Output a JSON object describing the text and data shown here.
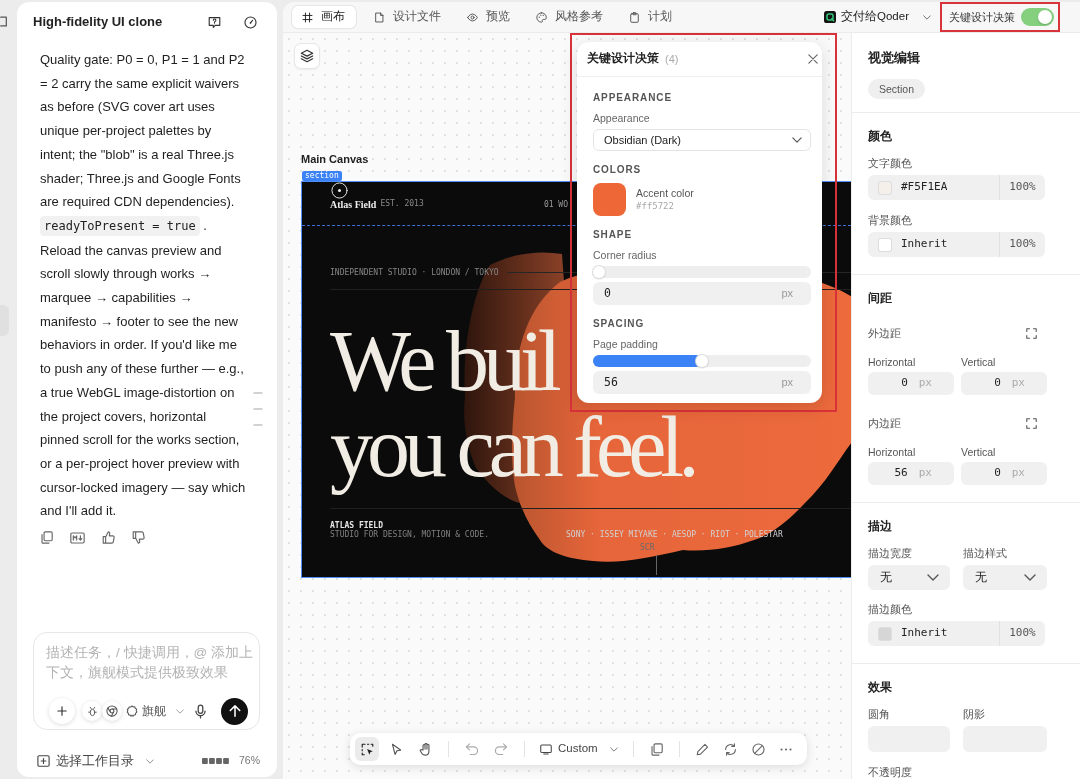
{
  "chat": {
    "title": "High-fidelity UI clone",
    "message": [
      {
        "kind": "text",
        "text": "Quality gate: P0 = 0, P1 = 1 and P2 = 2 carry the same explicit waivers as before (SVG cover art uses unique per-project palettes by intent; the \"blob\" is a real Three.js shader; Three.js and Google Fonts are required CDN dependencies)."
      },
      {
        "kind": "code",
        "text": "readyToPresent = true"
      },
      {
        "kind": "text",
        "text": "."
      },
      {
        "kind": "paragraph",
        "text": "Reload the canvas preview and scroll slowly through works → marquee → capabilities → manifesto → footer to see the new behaviors in order. If you'd like me to push any of these further — e.g., a true WebGL image-distortion on the project covers, horizontal pinned scroll for the works section, or a per-project hover preview with cursor-locked imagery — say which and I'll add it."
      }
    ],
    "composer": {
      "placeholder": "描述任务，/ 快捷调用，@ 添加上下文，旗舰模式提供极致效果",
      "mode": "旗舰"
    },
    "footer": {
      "workspace": "选择工作目录",
      "usage": "76%"
    }
  },
  "topbar": {
    "tabs": [
      {
        "label": "画布",
        "selected": true
      },
      {
        "label": "设计文件",
        "selected": false
      },
      {
        "label": "预览",
        "selected": false
      },
      {
        "label": "风格参考",
        "selected": false
      },
      {
        "label": "计划",
        "selected": false
      }
    ],
    "handoff": "交付给Qoder",
    "decisions": {
      "label": "关键设计决策",
      "on": true
    }
  },
  "canvas": {
    "frame_label": "Main Canvas",
    "frame_tag": "section",
    "artboard": {
      "brand": "Atlas Field",
      "established": "EST. 2013",
      "nav_link": "01 WO",
      "tagline": "INDEPENDENT STUDIO · LONDON / TOKYO",
      "headline": [
        "We buil",
        "you can feel."
      ],
      "footer_title": "ATLAS FIELD",
      "footer_text": "STUDIO FOR DESIGN, MOTION & CODE.",
      "clients": "SONY · ISSEY MIYAKE · AESOP · RIOT · POLESTAR",
      "scroll_hint": "SCR"
    }
  },
  "decisions_panel": {
    "title": "关键设计决策",
    "count": "(4)",
    "sections": [
      {
        "heading": "APPEARANCE",
        "kind": "select",
        "label": "Appearance",
        "value": "Obsidian (Dark)"
      },
      {
        "heading": "COLORS",
        "kind": "color",
        "label": "Accent color",
        "value": "#ff5722",
        "color": "#ee6736"
      },
      {
        "heading": "SHAPE",
        "kind": "slider",
        "label": "Corner radius",
        "level": 0,
        "value": "0",
        "unit": "px"
      },
      {
        "heading": "SPACING",
        "kind": "slider",
        "label": "Page padding",
        "level": 0.5,
        "value": "56",
        "unit": "px"
      }
    ]
  },
  "toolbar": {
    "tools": [
      {
        "selected": true
      },
      {
        "selected": false
      },
      {
        "selected": false
      }
    ],
    "preset": "Custom"
  },
  "inspector": {
    "title": "视觉编辑",
    "element": "Section",
    "groups": [
      {
        "heading": "颜色",
        "rows": [
          {
            "kind": "color",
            "label": "文字颜色",
            "value": "#F5F1EA",
            "opacity": "100%",
            "color": "#f5f1ea"
          },
          {
            "kind": "color",
            "label": "背景颜色",
            "value": "Inherit",
            "opacity": "100%",
            "color": "#ffffff"
          }
        ]
      },
      {
        "heading": "间距",
        "rows": [
          {
            "kind": "spacing",
            "label": "外边距",
            "fields": [
              {
                "label": "Horizontal",
                "value": "0",
                "unit": "px"
              },
              {
                "label": "Vertical",
                "value": "0",
                "unit": "px"
              }
            ]
          },
          {
            "kind": "spacing",
            "label": "内边距",
            "fields": [
              {
                "label": "Horizontal",
                "value": "56",
                "unit": "px"
              },
              {
                "label": "Vertical",
                "value": "0",
                "unit": "px"
              }
            ]
          }
        ]
      },
      {
        "heading": "描边",
        "rows": [
          {
            "kind": "selects",
            "fields": [
              {
                "label": "描边宽度",
                "value": "无"
              },
              {
                "label": "描边样式",
                "value": "无"
              }
            ]
          },
          {
            "kind": "color",
            "label": "描边颜色",
            "value": "Inherit",
            "opacity": "100%",
            "color": "#d6d6d6"
          }
        ]
      },
      {
        "heading": "效果",
        "rows": [
          {
            "kind": "blanks",
            "fields": [
              {
                "label": "圆角"
              },
              {
                "label": "阴影"
              }
            ]
          },
          {
            "kind": "label",
            "label": "不透明度"
          }
        ]
      }
    ]
  }
}
